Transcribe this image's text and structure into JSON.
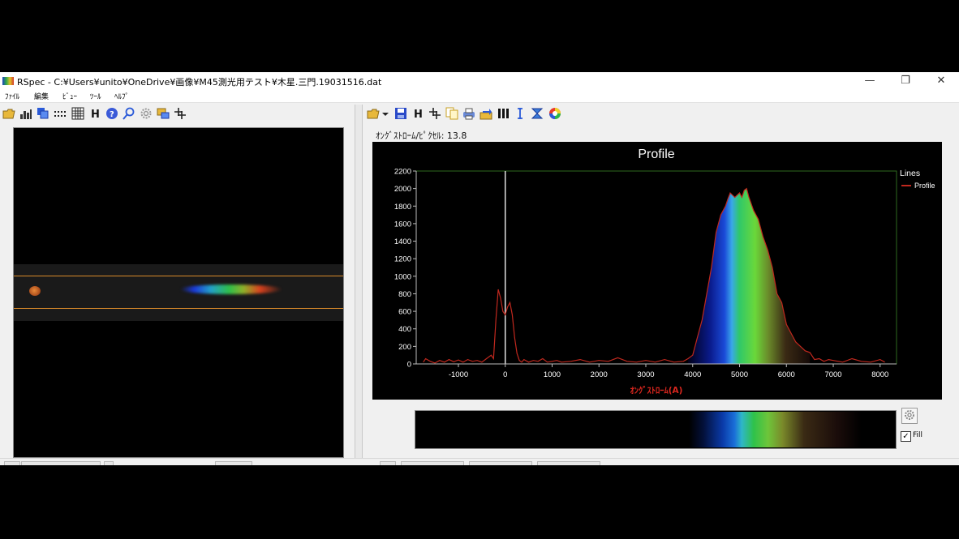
{
  "window": {
    "title": "RSpec - C:¥Users¥unito¥OneDrive¥画像¥M45測光用テスト¥木星.三門.19031516.dat",
    "minimize": "—",
    "maximize": "❐",
    "close": "✕"
  },
  "menu": [
    "ﾌｧｲﾙ",
    "編集",
    "ﾋﾞｭｰ",
    "ﾂｰﾙ",
    "ﾍﾙﾌﾟ"
  ],
  "toolbar_left": [
    "open-folder-icon",
    "bar-chart-icon",
    "copy-layers-icon",
    "dotted-grid-icon",
    "grid-icon",
    "h-icon",
    "help-icon",
    "search-icon",
    "gear-icon",
    "overlay-icon",
    "crosshair-icon"
  ],
  "toolbar_right": [
    "open-folder-icon",
    "save-icon",
    "h-icon",
    "crosshair-icon",
    "copy-icon",
    "print-icon",
    "export-icon",
    "bars-icon",
    "cursor-icon",
    "hourglass-icon",
    "color-wheel-icon"
  ],
  "pixel_label": "ｵﾝｸﾞｽﾄﾛｰﾑ/ﾋﾟｸｾﾙ: 13.8",
  "fill_label": "Fill",
  "fill_checked": "✓",
  "colors": {
    "plot_line": "#c0281e",
    "plot_frame": "#2e6a1e",
    "marker_line": "#e0e0e0",
    "axis_label": "#d8261e"
  },
  "chart_data": {
    "type": "line",
    "title": "Profile",
    "xlabel": "ｵﾝｸﾞｽﾄﾛｰﾑ(A)",
    "ylabel": "",
    "xlim": [
      -1900,
      8350
    ],
    "ylim": [
      0,
      2200
    ],
    "x_ticks": [
      -1000,
      0,
      1000,
      2000,
      3000,
      4000,
      5000,
      6000,
      7000,
      8000
    ],
    "y_ticks": [
      0,
      200,
      400,
      600,
      800,
      1000,
      1200,
      1400,
      1600,
      1800,
      2000,
      2200
    ],
    "x_tick_labels": [
      "-1000",
      "0",
      "1000",
      "2000",
      "3000",
      "4000",
      "5000",
      "6000",
      "7000",
      "8000"
    ],
    "y_tick_labels": [
      "0",
      "200",
      "400",
      "600",
      "800",
      "1000",
      "1200",
      "1400",
      "1600",
      "1800",
      "2000",
      "2200"
    ],
    "grid": false,
    "legend": {
      "title": "Lines",
      "entries": [
        "Profile"
      ],
      "position": "right"
    },
    "marker_x": 0,
    "series": [
      {
        "name": "Profile",
        "x": [
          -1750,
          -1700,
          -1600,
          -1500,
          -1400,
          -1300,
          -1200,
          -1100,
          -1000,
          -900,
          -800,
          -700,
          -600,
          -500,
          -400,
          -300,
          -250,
          -200,
          -150,
          -100,
          -50,
          0,
          50,
          100,
          150,
          200,
          250,
          300,
          350,
          400,
          500,
          600,
          700,
          800,
          900,
          1000,
          1100,
          1200,
          1400,
          1600,
          1800,
          2000,
          2200,
          2400,
          2600,
          2800,
          3000,
          3200,
          3400,
          3600,
          3800,
          3900,
          4000,
          4100,
          4200,
          4300,
          4400,
          4500,
          4600,
          4700,
          4750,
          4800,
          4900,
          5000,
          5050,
          5100,
          5150,
          5200,
          5300,
          5400,
          5500,
          5600,
          5700,
          5800,
          5900,
          6000,
          6100,
          6200,
          6300,
          6400,
          6500,
          6600,
          6700,
          6800,
          6900,
          7000,
          7200,
          7400,
          7600,
          7800,
          8000,
          8100
        ],
        "y": [
          20,
          60,
          30,
          10,
          40,
          20,
          50,
          25,
          45,
          20,
          50,
          30,
          40,
          20,
          60,
          100,
          60,
          500,
          850,
          750,
          600,
          560,
          650,
          700,
          560,
          300,
          120,
          40,
          20,
          50,
          20,
          40,
          30,
          60,
          20,
          30,
          40,
          20,
          30,
          50,
          20,
          40,
          30,
          70,
          30,
          20,
          40,
          20,
          50,
          20,
          30,
          60,
          100,
          300,
          500,
          800,
          1100,
          1500,
          1700,
          1800,
          1880,
          1950,
          1900,
          1950,
          1900,
          1980,
          2000,
          1900,
          1750,
          1650,
          1450,
          1300,
          1100,
          800,
          700,
          450,
          350,
          250,
          200,
          150,
          130,
          50,
          60,
          30,
          50,
          40,
          20,
          60,
          30,
          20,
          50,
          20
        ]
      }
    ]
  }
}
